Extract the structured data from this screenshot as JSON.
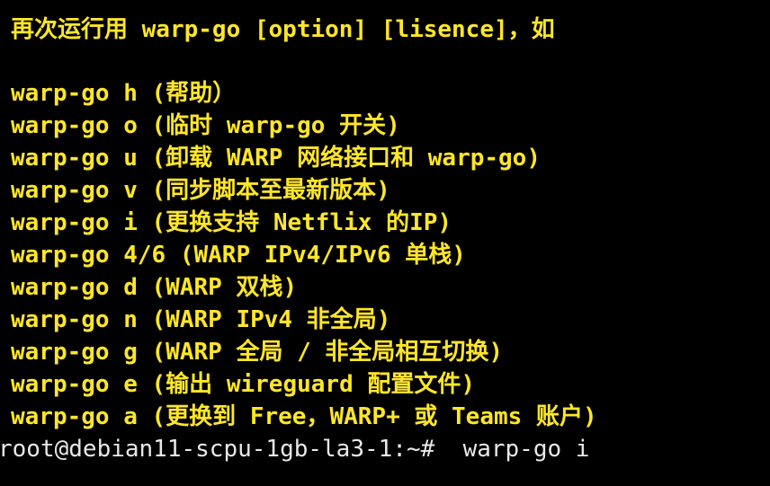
{
  "terminal": {
    "intro": "再次运行用 warp-go [option] [lisence]，如",
    "commands": [
      "warp-go h (帮助）",
      "warp-go o (临时 warp-go 开关)",
      "warp-go u (卸载 WARP 网络接口和 warp-go)",
      "warp-go v (同步脚本至最新版本)",
      "warp-go i (更换支持 Netflix 的IP)",
      "warp-go 4/6 (WARP IPv4/IPv6 单栈)",
      "warp-go d (WARP 双栈)",
      "warp-go n (WARP IPv4 非全局)",
      "warp-go g (WARP 全局 / 非全局相互切换)",
      "warp-go e (输出 wireguard 配置文件)",
      "warp-go a (更换到 Free，WARP+ 或 Teams 账户)"
    ],
    "prompt": "root@debian11-scpu-1gb-la3-1:~#",
    "input": "  warp-go i",
    "colors": {
      "background": "#000000",
      "highlight": "#ffe629",
      "prompt": "#e8e8e8"
    }
  }
}
